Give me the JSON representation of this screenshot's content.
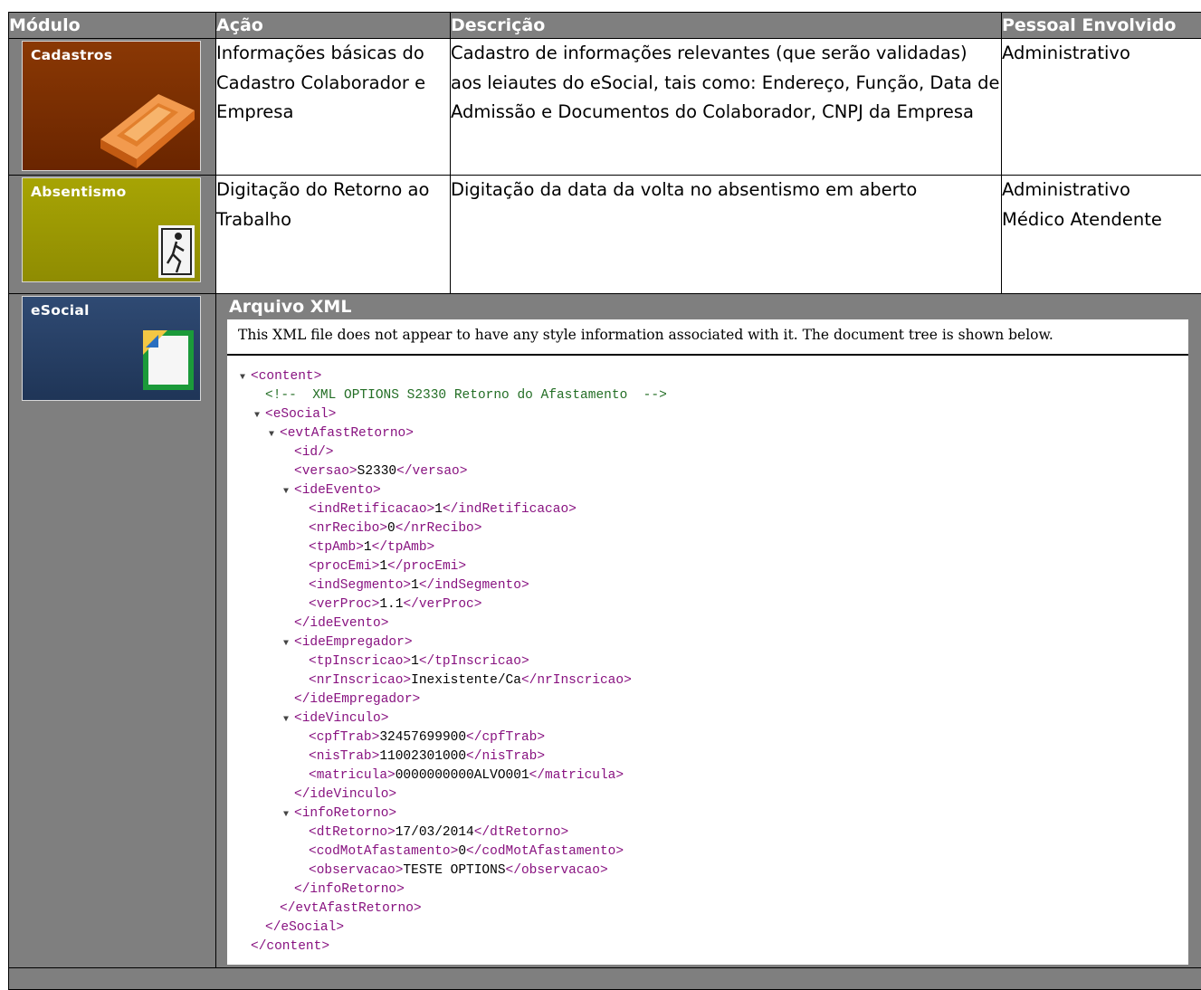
{
  "headers": {
    "modulo": "Módulo",
    "acao": "Ação",
    "descricao": "Descrição",
    "pessoal": "Pessoal Envolvido"
  },
  "rows": [
    {
      "module_label": "Cadastros",
      "module_icon": "brick-icon",
      "acao": "Informações básicas do Cadastro Colaborador e Empresa",
      "descricao": "Cadastro de informações relevantes (que serão validadas) aos leiautes do eSocial, tais como: Endereço, Função, Data de Admissão e Documentos do Colaborador, CNPJ da Empresa",
      "pessoal": [
        "Administrativo"
      ]
    },
    {
      "module_label": "Absentismo",
      "module_icon": "exit-door-icon",
      "acao": "Digitação do Retorno ao Trabalho",
      "descricao": "Digitação da data da volta no absentismo em aberto",
      "pessoal": [
        "Administrativo",
        "Médico Atendente"
      ]
    }
  ],
  "esocial_row": {
    "module_label": "eSocial",
    "module_icon": "document-icon",
    "section_title": "Arquivo XML",
    "xml_note": "This XML file does not appear to have any style information associated with it. The document tree is shown below.",
    "xml_lines": [
      {
        "indent": 0,
        "toggle": true,
        "kind": "open",
        "tag": "content"
      },
      {
        "indent": 1,
        "toggle": false,
        "kind": "comment",
        "text": "<!--  XML OPTIONS S2330 Retorno do Afastamento  -->"
      },
      {
        "indent": 1,
        "toggle": true,
        "kind": "open",
        "tag": "eSocial"
      },
      {
        "indent": 2,
        "toggle": true,
        "kind": "open",
        "tag": "evtAfastRetorno"
      },
      {
        "indent": 3,
        "toggle": false,
        "kind": "empty",
        "tag": "id"
      },
      {
        "indent": 3,
        "toggle": false,
        "kind": "leaf",
        "tag": "versao",
        "value": "S2330"
      },
      {
        "indent": 3,
        "toggle": true,
        "kind": "open",
        "tag": "ideEvento"
      },
      {
        "indent": 4,
        "toggle": false,
        "kind": "leaf",
        "tag": "indRetificacao",
        "value": "1"
      },
      {
        "indent": 4,
        "toggle": false,
        "kind": "leaf",
        "tag": "nrRecibo",
        "value": "0"
      },
      {
        "indent": 4,
        "toggle": false,
        "kind": "leaf",
        "tag": "tpAmb",
        "value": "1"
      },
      {
        "indent": 4,
        "toggle": false,
        "kind": "leaf",
        "tag": "procEmi",
        "value": "1"
      },
      {
        "indent": 4,
        "toggle": false,
        "kind": "leaf",
        "tag": "indSegmento",
        "value": "1"
      },
      {
        "indent": 4,
        "toggle": false,
        "kind": "leaf",
        "tag": "verProc",
        "value": "1.1"
      },
      {
        "indent": 3,
        "toggle": false,
        "kind": "close",
        "tag": "ideEvento"
      },
      {
        "indent": 3,
        "toggle": true,
        "kind": "open",
        "tag": "ideEmpregador"
      },
      {
        "indent": 4,
        "toggle": false,
        "kind": "leaf",
        "tag": "tpInscricao",
        "value": "1"
      },
      {
        "indent": 4,
        "toggle": false,
        "kind": "leaf",
        "tag": "nrInscricao",
        "value": "Inexistente/Ca"
      },
      {
        "indent": 3,
        "toggle": false,
        "kind": "close",
        "tag": "ideEmpregador"
      },
      {
        "indent": 3,
        "toggle": true,
        "kind": "open",
        "tag": "ideVinculo"
      },
      {
        "indent": 4,
        "toggle": false,
        "kind": "leaf",
        "tag": "cpfTrab",
        "value": "32457699900"
      },
      {
        "indent": 4,
        "toggle": false,
        "kind": "leaf",
        "tag": "nisTrab",
        "value": "11002301000"
      },
      {
        "indent": 4,
        "toggle": false,
        "kind": "leaf",
        "tag": "matricula",
        "value": "0000000000ALVO001"
      },
      {
        "indent": 3,
        "toggle": false,
        "kind": "close",
        "tag": "ideVinculo"
      },
      {
        "indent": 3,
        "toggle": true,
        "kind": "open",
        "tag": "infoRetorno"
      },
      {
        "indent": 4,
        "toggle": false,
        "kind": "leaf",
        "tag": "dtRetorno",
        "value": "17/03/2014"
      },
      {
        "indent": 4,
        "toggle": false,
        "kind": "leaf",
        "tag": "codMotAfastamento",
        "value": "0"
      },
      {
        "indent": 4,
        "toggle": false,
        "kind": "leaf",
        "tag": "observacao",
        "value": "TESTE OPTIONS"
      },
      {
        "indent": 3,
        "toggle": false,
        "kind": "close",
        "tag": "infoRetorno"
      },
      {
        "indent": 2,
        "toggle": false,
        "kind": "close",
        "tag": "evtAfastRetorno"
      },
      {
        "indent": 1,
        "toggle": false,
        "kind": "close",
        "tag": "eSocial"
      },
      {
        "indent": 0,
        "toggle": false,
        "kind": "close",
        "tag": "content"
      }
    ]
  },
  "colors": {
    "header_bg": "#7f7f7f",
    "cadastros_tile": "#7a2e02",
    "absentismo_tile": "#9c9a03",
    "esocial_tile": "#27406a",
    "xml_tag": "#881280",
    "xml_comment": "#236e25"
  }
}
